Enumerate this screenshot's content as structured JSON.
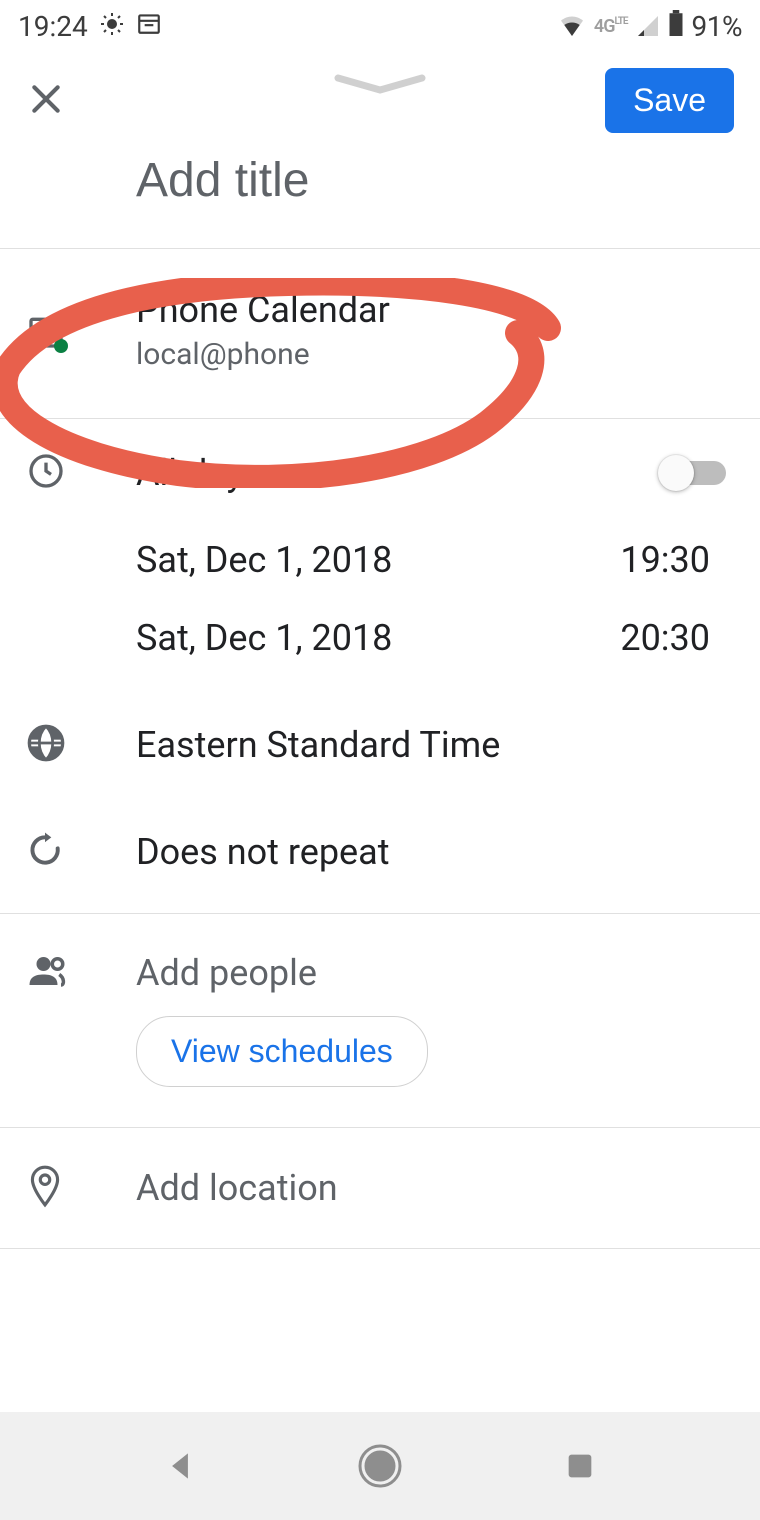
{
  "status": {
    "time": "19:24",
    "network": "4G LTE",
    "battery": "91%"
  },
  "header": {
    "save_label": "Save"
  },
  "title": {
    "placeholder": "Add title",
    "value": ""
  },
  "calendar": {
    "name": "Phone Calendar",
    "account": "local@phone"
  },
  "time": {
    "allday_label": "All-day",
    "allday_on": false,
    "start_date": "Sat, Dec 1, 2018",
    "start_time": "19:30",
    "end_date": "Sat, Dec 1, 2018",
    "end_time": "20:30",
    "timezone": "Eastern Standard Time",
    "repeat": "Does not repeat"
  },
  "people": {
    "placeholder": "Add people",
    "schedules_label": "View schedules"
  },
  "location": {
    "placeholder": "Add location"
  }
}
